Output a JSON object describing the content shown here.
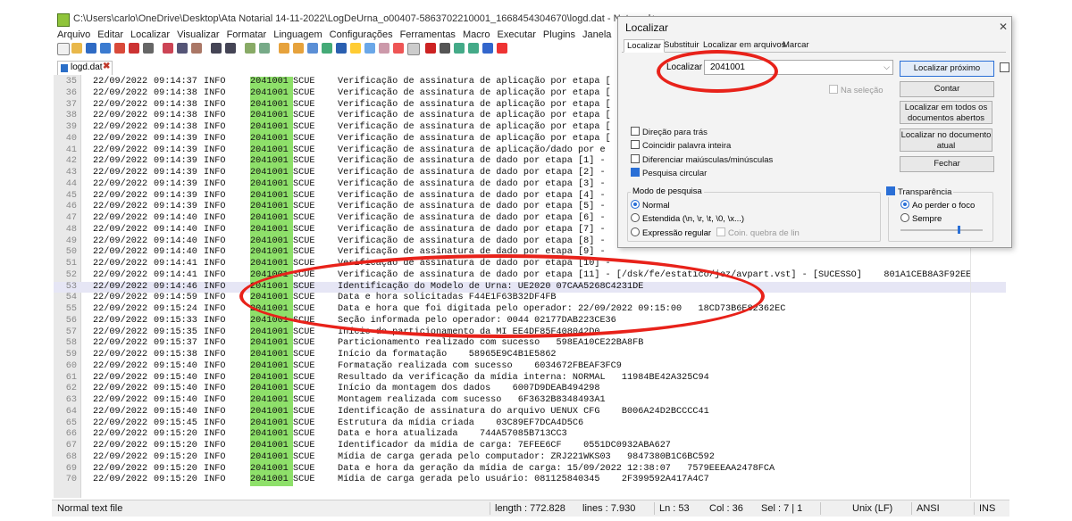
{
  "window": {
    "title": "C:\\Users\\carlo\\OneDrive\\Desktop\\Ata Notarial 14-11-2022\\LogDeUrna_o00407-5863702210001_1668454304670\\logd.dat - Notepad+"
  },
  "menu": [
    "Arquivo",
    "Editar",
    "Localizar",
    "Visualizar",
    "Formatar",
    "Linguagem",
    "Configurações",
    "Ferramentas",
    "Macro",
    "Executar",
    "Plugins",
    "Janela",
    "?"
  ],
  "tab": {
    "label": "logd.dat",
    "close": "✖"
  },
  "log_lines": [
    {
      "n": "35",
      "date": "22/09/2022",
      "time": "09:14:37",
      "level": "INFO",
      "code": "2041001",
      "mod": "SCUE",
      "msg": "Verificação de assinatura de aplicação por etapa ["
    },
    {
      "n": "36",
      "date": "22/09/2022",
      "time": "09:14:38",
      "level": "INFO",
      "code": "2041001",
      "mod": "SCUE",
      "msg": "Verificação de assinatura de aplicação por etapa ["
    },
    {
      "n": "37",
      "date": "22/09/2022",
      "time": "09:14:38",
      "level": "INFO",
      "code": "2041001",
      "mod": "SCUE",
      "msg": "Verificação de assinatura de aplicação por etapa ["
    },
    {
      "n": "38",
      "date": "22/09/2022",
      "time": "09:14:38",
      "level": "INFO",
      "code": "2041001",
      "mod": "SCUE",
      "msg": "Verificação de assinatura de aplicação por etapa ["
    },
    {
      "n": "39",
      "date": "22/09/2022",
      "time": "09:14:38",
      "level": "INFO",
      "code": "2041001",
      "mod": "SCUE",
      "msg": "Verificação de assinatura de aplicação por etapa ["
    },
    {
      "n": "40",
      "date": "22/09/2022",
      "time": "09:14:39",
      "level": "INFO",
      "code": "2041001",
      "mod": "SCUE",
      "msg": "Verificação de assinatura de aplicação por etapa ["
    },
    {
      "n": "41",
      "date": "22/09/2022",
      "time": "09:14:39",
      "level": "INFO",
      "code": "2041001",
      "mod": "SCUE",
      "msg": "Verificação de assinatura de aplicação/dado por e"
    },
    {
      "n": "42",
      "date": "22/09/2022",
      "time": "09:14:39",
      "level": "INFO",
      "code": "2041001",
      "mod": "SCUE",
      "msg": "Verificação de assinatura de dado por etapa [1] -"
    },
    {
      "n": "43",
      "date": "22/09/2022",
      "time": "09:14:39",
      "level": "INFO",
      "code": "2041001",
      "mod": "SCUE",
      "msg": "Verificação de assinatura de dado por etapa [2] -"
    },
    {
      "n": "44",
      "date": "22/09/2022",
      "time": "09:14:39",
      "level": "INFO",
      "code": "2041001",
      "mod": "SCUE",
      "msg": "Verificação de assinatura de dado por etapa [3] -"
    },
    {
      "n": "45",
      "date": "22/09/2022",
      "time": "09:14:39",
      "level": "INFO",
      "code": "2041001",
      "mod": "SCUE",
      "msg": "Verificação de assinatura de dado por etapa [4] -"
    },
    {
      "n": "46",
      "date": "22/09/2022",
      "time": "09:14:39",
      "level": "INFO",
      "code": "2041001",
      "mod": "SCUE",
      "msg": "Verificação de assinatura de dado por etapa [5] -"
    },
    {
      "n": "47",
      "date": "22/09/2022",
      "time": "09:14:40",
      "level": "INFO",
      "code": "2041001",
      "mod": "SCUE",
      "msg": "Verificação de assinatura de dado por etapa [6] -"
    },
    {
      "n": "48",
      "date": "22/09/2022",
      "time": "09:14:40",
      "level": "INFO",
      "code": "2041001",
      "mod": "SCUE",
      "msg": "Verificação de assinatura de dado por etapa [7] -"
    },
    {
      "n": "49",
      "date": "22/09/2022",
      "time": "09:14:40",
      "level": "INFO",
      "code": "2041001",
      "mod": "SCUE",
      "msg": "Verificação de assinatura de dado por etapa [8] -"
    },
    {
      "n": "50",
      "date": "22/09/2022",
      "time": "09:14:40",
      "level": "INFO",
      "code": "2041001",
      "mod": "SCUE",
      "msg": "Verificação de assinatura de dado por etapa [9] -"
    },
    {
      "n": "51",
      "date": "22/09/2022",
      "time": "09:14:41",
      "level": "INFO",
      "code": "2041001",
      "mod": "SCUE",
      "msg": "Verificação de assinatura de dado por etapa [10] -"
    },
    {
      "n": "52",
      "date": "22/09/2022",
      "time": "09:14:41",
      "level": "INFO",
      "code": "2041001",
      "mod": "SCUE",
      "msg": "Verificação de assinatura de dado por etapa [11] - [/dsk/fe/estatico/jez/avpart.vst] - [SUCESSO]    801A1CEB8A3F92EE"
    },
    {
      "n": "53",
      "date": "22/09/2022",
      "time": "09:14:46",
      "level": "INFO",
      "code": "2041001",
      "mod": "SCUE",
      "msg": "Identificação do Modelo de Urna: UE2020 07CAA5268C4231DE"
    },
    {
      "n": "54",
      "date": "22/09/2022",
      "time": "09:14:59",
      "level": "INFO",
      "code": "2041001",
      "mod": "SCUE",
      "msg": "Data e hora solicitadas F44E1F63B32DF4FB"
    },
    {
      "n": "55",
      "date": "22/09/2022",
      "time": "09:15:24",
      "level": "INFO",
      "code": "2041001",
      "mod": "SCUE",
      "msg": "Data e hora que foi digitada pelo operador: 22/09/2022 09:15:00   18CD73B6E82362EC"
    },
    {
      "n": "56",
      "date": "22/09/2022",
      "time": "09:15:33",
      "level": "INFO",
      "code": "2041001",
      "mod": "SCUE",
      "msg": "Seção informada pelo operador: 0044 02177DAB223CE36"
    },
    {
      "n": "57",
      "date": "22/09/2022",
      "time": "09:15:35",
      "level": "INFO",
      "code": "2041001",
      "mod": "SCUE",
      "msg": "Início do particionamento da MI EE4DF85F408042D0"
    },
    {
      "n": "58",
      "date": "22/09/2022",
      "time": "09:15:37",
      "level": "INFO",
      "code": "2041001",
      "mod": "SCUE",
      "msg": "Particionamento realizado com sucesso   598EA10CE22BA8FB"
    },
    {
      "n": "59",
      "date": "22/09/2022",
      "time": "09:15:38",
      "level": "INFO",
      "code": "2041001",
      "mod": "SCUE",
      "msg": "Início da formatação    58965E9C4B1E5862"
    },
    {
      "n": "60",
      "date": "22/09/2022",
      "time": "09:15:40",
      "level": "INFO",
      "code": "2041001",
      "mod": "SCUE",
      "msg": "Formatação realizada com sucesso    6034672FBEAF3FC9"
    },
    {
      "n": "61",
      "date": "22/09/2022",
      "time": "09:15:40",
      "level": "INFO",
      "code": "2041001",
      "mod": "SCUE",
      "msg": "Resultado da verificação da mídia interna: NORMAL   11984BE42A325C94"
    },
    {
      "n": "62",
      "date": "22/09/2022",
      "time": "09:15:40",
      "level": "INFO",
      "code": "2041001",
      "mod": "SCUE",
      "msg": "Início da montagem dos dados    6007D9DEAB494298"
    },
    {
      "n": "63",
      "date": "22/09/2022",
      "time": "09:15:40",
      "level": "INFO",
      "code": "2041001",
      "mod": "SCUE",
      "msg": "Montagem realizada com sucesso   6F3632B8348493A1"
    },
    {
      "n": "64",
      "date": "22/09/2022",
      "time": "09:15:40",
      "level": "INFO",
      "code": "2041001",
      "mod": "SCUE",
      "msg": "Identificação de assinatura do arquivo UENUX CFG    B006A24D2BCCCC41"
    },
    {
      "n": "65",
      "date": "22/09/2022",
      "time": "09:15:45",
      "level": "INFO",
      "code": "2041001",
      "mod": "SCUE",
      "msg": "Estrutura da mídia criada    03C89EF7DCA4D5C6"
    },
    {
      "n": "66",
      "date": "22/09/2022",
      "time": "09:15:20",
      "level": "INFO",
      "code": "2041001",
      "mod": "SCUE",
      "msg": "Data e hora atualizada    744A57085B713CC3"
    },
    {
      "n": "67",
      "date": "22/09/2022",
      "time": "09:15:20",
      "level": "INFO",
      "code": "2041001",
      "mod": "SCUE",
      "msg": "Identificador da mídia de carga: 7EFEE6CF    0551DC0932ABA627"
    },
    {
      "n": "68",
      "date": "22/09/2022",
      "time": "09:15:20",
      "level": "INFO",
      "code": "2041001",
      "mod": "SCUE",
      "msg": "Mídia de carga gerada pelo computador: ZRJ221WKS03   9847380B1C6BC592"
    },
    {
      "n": "69",
      "date": "22/09/2022",
      "time": "09:15:20",
      "level": "INFO",
      "code": "2041001",
      "mod": "SCUE",
      "msg": "Data e hora da geração da mídia de carga: 15/09/2022 12:38:07   7579EEEAA2478FCA"
    },
    {
      "n": "70",
      "date": "22/09/2022",
      "time": "09:15:20",
      "level": "INFO",
      "code": "2041001",
      "mod": "SCUE",
      "msg": "Mídia de carga gerada pelo usuário: 081125840345    2F399592A417A4C7"
    }
  ],
  "current_line": "53",
  "statusbar": {
    "type": "Normal text file",
    "length": "length : 772.828",
    "lines": "lines : 7.930",
    "ln": "Ln : 53",
    "col": "Col : 36",
    "sel": "Sel : 7 | 1",
    "eol": "Unix (LF)",
    "enc": "ANSI",
    "ins": "INS"
  },
  "find_dialog": {
    "title": "Localizar",
    "close": "✕",
    "tabs": [
      "Localizar",
      "Substituir",
      "Localizar em arquivos",
      "Marcar"
    ],
    "find_label": "Localizar :",
    "find_value": "2041001",
    "buttons": {
      "find_next": "Localizar próximo",
      "count": "Contar",
      "find_all_open_l1": "Localizar em todos os",
      "find_all_open_l2": "documentos abertos",
      "find_current_l1": "Localizar no documento",
      "find_current_l2": "atual",
      "close": "Fechar"
    },
    "in_selection": "Na seleção",
    "options": {
      "backward": "Direção para trás",
      "whole_word": "Coincidir palavra inteira",
      "match_case": "Diferenciar maiúsculas/minúsculas",
      "wrap": "Pesquisa circular"
    },
    "search_mode": {
      "label": "Modo de pesquisa",
      "normal": "Normal",
      "extended": "Estendida (\\n, \\r, \\t, \\0, \\x...)",
      "regex": "Expressão regular",
      "dot_newline": "Coin. quebra de lin"
    },
    "transparency": {
      "label": "Transparência",
      "on_lose_focus": "Ao perder o foco",
      "always": "Sempre"
    }
  }
}
